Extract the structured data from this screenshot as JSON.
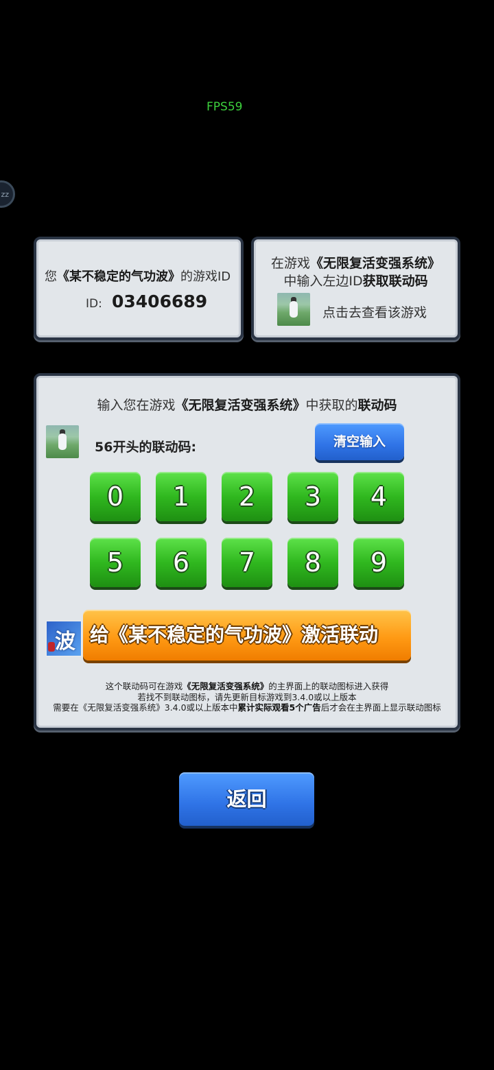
{
  "hud": {
    "fps": "FPS59",
    "side_tab": "zz"
  },
  "id_panel": {
    "prefix": "您",
    "game_title": "《某不稳定的气功波》",
    "suffix": "的游戏ID",
    "id_label": "ID:",
    "id_value": "03406689"
  },
  "info_panel": {
    "line1_prefix": "在游戏",
    "line1_game": "《无限复活变强系统》",
    "line2_prefix": "中输入左边ID",
    "line2_bold": "获取联动码",
    "view_label": "点击去查看该游戏"
  },
  "code_panel": {
    "title_prefix": "输入您在游戏",
    "title_game": "《无限复活变强系统》",
    "title_mid": "中获取的",
    "title_bold": "联动码",
    "prefix_label": "56开头的联动码:",
    "clear_label": "清空输入",
    "keys": [
      "0",
      "1",
      "2",
      "3",
      "4",
      "5",
      "6",
      "7",
      "8",
      "9"
    ],
    "activate_icon_char": "波",
    "activate_label": "给《某不稳定的气功波》激活联动",
    "note1_prefix": "这个联动码可在游戏",
    "note1_game": "《无限复活变强系统》",
    "note1_suffix": "的主界面上的联动图标进入获得",
    "note2": "若找不到联动图标，请先更新目标游戏到3.4.0或以上版本",
    "note3_prefix": "需要在《无限复活变强系统》3.4.0或以上版本中",
    "note3_bold": "累计实际观看5个广告",
    "note3_suffix": "后才会在主界面上显示联动图标"
  },
  "back_label": "返回",
  "colors": {
    "fps": "#3dd13d",
    "key_green": "#30b81f",
    "button_blue": "#2f73e6",
    "button_orange": "#ff9a14"
  }
}
